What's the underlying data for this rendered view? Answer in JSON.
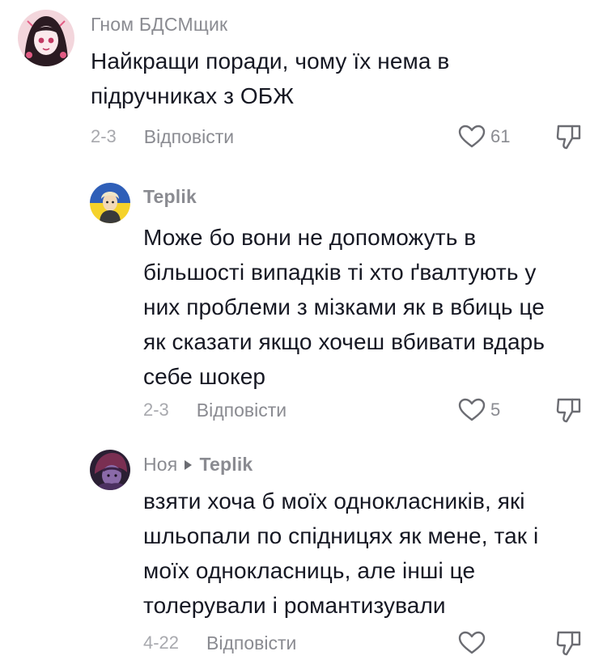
{
  "comments": [
    {
      "username": "Гном БДСМщик",
      "text_lines": [
        "Найкращи поради, чому їх нема в",
        "підручниках з ОБЖ"
      ],
      "date": "2-3",
      "reply_label": "Відповісти",
      "likes": "61",
      "avatar_icon": "anime-girl-avatar"
    },
    {
      "username": "Teplik",
      "text_lines": [
        "Може бо вони не допоможуть в",
        "більшості випадків ті хто ґвалтують у",
        "них проблеми з мізками як в вбиць це",
        "як сказати якщо хочеш вбивати вдарь",
        "себе шокер"
      ],
      "date": "2-3",
      "reply_label": "Відповісти",
      "likes": "5",
      "avatar_icon": "ukraine-flag-avatar"
    },
    {
      "username": "Ноя",
      "reply_to": "Teplik",
      "text_lines": [
        "взяти хоча б моїх однокласників, які",
        "шльопали по спідницях як мене, так і",
        "моїх однокласниць, але інші це",
        "толерували і романтизували"
      ],
      "date": "4-22",
      "reply_label": "Відповісти",
      "likes": "",
      "avatar_icon": "purple-character-avatar"
    }
  ],
  "colors": {
    "text": "#161823",
    "secondary": "#8a8b91",
    "date": "#a8a9ae",
    "icon": "#6b6c72"
  }
}
